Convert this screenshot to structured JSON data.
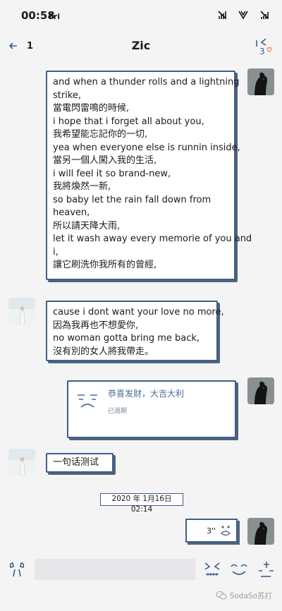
{
  "status_bar": {
    "time": "00:58",
    "day": "Fri"
  },
  "nav": {
    "back_count": "1",
    "title": "Zic"
  },
  "messages": {
    "lyrics_out": {
      "lines": [
        "and when a thunder rolls and a lightning",
        "strike,",
        "當電閃雷鳴的時候,",
        "i hope that i forget all about you,",
        "我希望能忘記你的一切,",
        "yea when everyone else is runnin inside,",
        "當另一個人闖入我的生活,",
        "i will feel it so brand-new,",
        "我將煥然一新,",
        "so baby let the rain fall down from",
        "heaven,",
        "所以請天降大雨,",
        "let it wash away every memorie of you and",
        "i,",
        "讓它刷洗你我所有的曾經,"
      ]
    },
    "lyrics_in": {
      "lines": [
        "cause i dont want your love no more,",
        "因為我再也不想愛你,",
        "no woman gotta bring me back,",
        "沒有別的女人將我帶走。"
      ]
    },
    "red_packet": {
      "title": "恭喜发财，大吉大利",
      "status": "已過期"
    },
    "short_in": {
      "text": "一句话测试"
    },
    "timestamp": "2020 年 1月16日 02:14",
    "voice": {
      "duration": "3''"
    }
  },
  "input": {
    "placeholder": ""
  },
  "watermark": {
    "text": "SodaSo苏打"
  },
  "colors": {
    "border": "#3f5f86",
    "shadow": "#50637c",
    "accent": "#4c6c95",
    "heart": "#e5857d"
  }
}
